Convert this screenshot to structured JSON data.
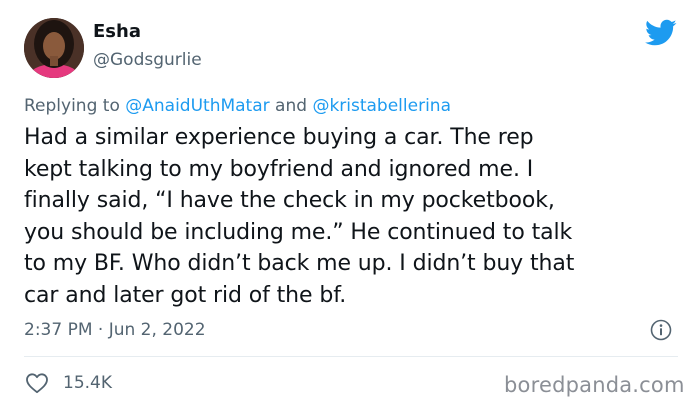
{
  "user": {
    "display_name": "Esha",
    "handle": "@Godsgurlie"
  },
  "reply": {
    "prefix": "Replying to ",
    "mention_1": "@AnaidUthMatar",
    "joiner": " and ",
    "mention_2": "@kristabellerina"
  },
  "tweet": {
    "text": "Had a similar experience buying a car. The rep\nkept talking to my boyfriend and ignored me. I\nfinally said, “I have the check in my pocketbook,\nyou should be including me.” He continued to talk\nto my BF. Who didn’t back me up. I didn’t buy that\ncar and later got rid of the bf.",
    "timestamp": "2:37 PM · Jun 2, 2022",
    "like_count": "15.4K"
  },
  "watermark": "boredpanda.com",
  "icons": {
    "brand": "twitter-bird-icon",
    "info": "info-icon",
    "like": "heart-icon"
  },
  "colors": {
    "twitter_blue": "#1d9bf0",
    "secondary_text": "#536471",
    "primary_text": "#0f1419"
  }
}
